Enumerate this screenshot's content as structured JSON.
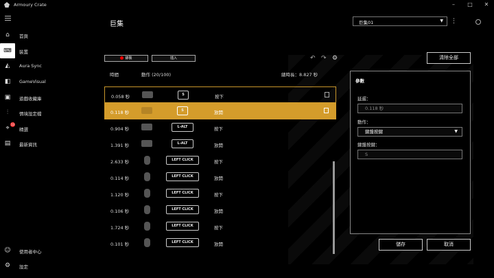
{
  "app": {
    "title": "Armoury Crate"
  },
  "sidebar": {
    "items": [
      {
        "label": "首頁",
        "icon": "home-icon"
      },
      {
        "label": "裝置",
        "icon": "keyboard-device-icon",
        "active": true
      },
      {
        "label": "Aura Sync",
        "icon": "aura-sync-icon"
      },
      {
        "label": "GameVisual",
        "icon": "gamevisual-icon"
      },
      {
        "label": "遊戲收藏庫",
        "icon": "game-library-icon"
      },
      {
        "label": "情境設定檔",
        "icon": "scenario-profiles-icon"
      },
      {
        "label": "精選",
        "icon": "featured-tag-icon",
        "badge": "13"
      },
      {
        "label": "最新資訊",
        "icon": "news-icon"
      }
    ],
    "bottom": [
      {
        "label": "使用者中心",
        "icon": "user-center-icon"
      },
      {
        "label": "設定",
        "icon": "settings-gear-icon"
      }
    ]
  },
  "header": {
    "title": "巨集",
    "macro_select": "巨集01"
  },
  "toolbar": {
    "record_label": "錄製",
    "insert_label": "插入",
    "clear_all_label": "清除全部"
  },
  "list": {
    "col_time": "時間",
    "col_action": "動作 (20/100)",
    "total_length": "總時長：8.827 秒",
    "rows": [
      {
        "time": "0.058 秒",
        "device": "keyboard",
        "key": "S",
        "action": "按下",
        "style": "outlined"
      },
      {
        "time": "0.118 秒",
        "device": "keyboard",
        "key": "S",
        "action": "放開",
        "style": "selected"
      },
      {
        "time": "0.904 秒",
        "device": "keyboard",
        "key": "L-ALT",
        "action": "按下"
      },
      {
        "time": "1.391 秒",
        "device": "keyboard",
        "key": "L-ALT",
        "action": "放開"
      },
      {
        "time": "2.633 秒",
        "device": "mouse",
        "key": "LEFT CLICK",
        "action": "按下"
      },
      {
        "time": "0.114 秒",
        "device": "mouse",
        "key": "LEFT CLICK",
        "action": "放開"
      },
      {
        "time": "1.120 秒",
        "device": "mouse",
        "key": "LEFT CLICK",
        "action": "按下"
      },
      {
        "time": "0.106 秒",
        "device": "mouse",
        "key": "LEFT CLICK",
        "action": "放開"
      },
      {
        "time": "1.724 秒",
        "device": "mouse",
        "key": "LEFT CLICK",
        "action": "按下"
      },
      {
        "time": "0.101 秒",
        "device": "mouse",
        "key": "LEFT CLICK",
        "action": "放開"
      }
    ]
  },
  "panel": {
    "title": "參數",
    "delay_label": "延遲：",
    "delay_value": "0.118 秒",
    "action_label": "動作：",
    "action_value": "鍵盤按鍵",
    "key_label": "鍵盤按鍵：",
    "key_value": "S"
  },
  "footer": {
    "save_label": "儲存",
    "cancel_label": "取消"
  },
  "colors": {
    "accent": "#d49c2b",
    "record_dot": "#e00000"
  }
}
